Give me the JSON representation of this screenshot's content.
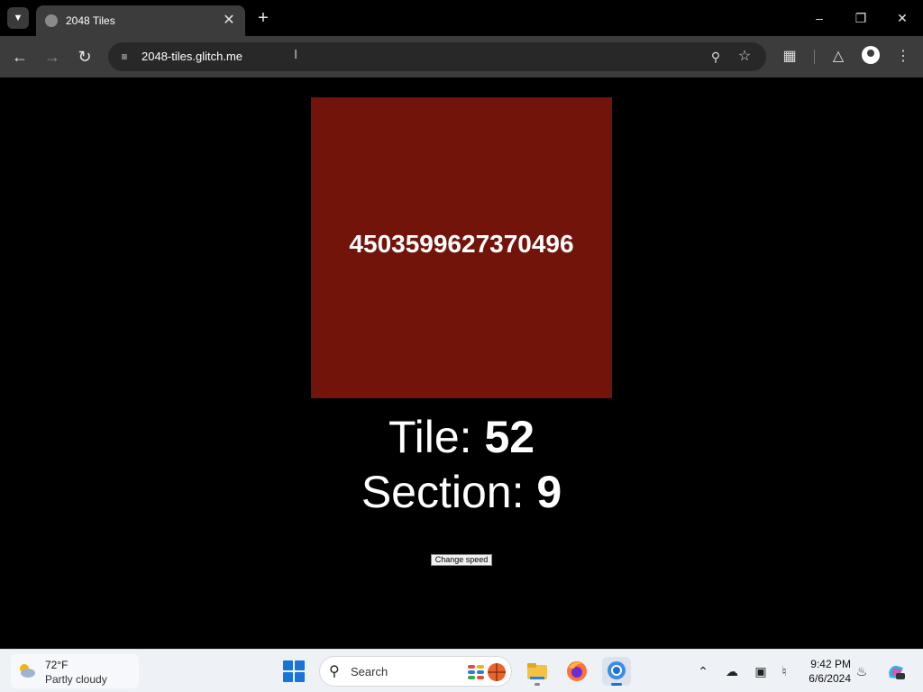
{
  "browser": {
    "tab_title": "2048 Tiles",
    "url": "2048-tiles.glitch.me"
  },
  "page": {
    "tile_value": "4503599627370496",
    "tile_color": "#72140a",
    "tile_label": "Tile: ",
    "tile_number": "52",
    "section_label": "Section: ",
    "section_number": "9",
    "change_speed_label": "Change speed"
  },
  "taskbar": {
    "weather_temp": "72°F",
    "weather_condition": "Partly cloudy",
    "search_placeholder": "Search",
    "time": "9:42 PM",
    "date": "6/6/2024"
  },
  "icons": {
    "tab_search": "chevron-down-icon",
    "favicon": "globe-icon",
    "back": "arrow-left-icon",
    "forward": "arrow-right-icon",
    "reload": "reload-icon",
    "site_info": "tune-icon",
    "zoom": "zoom-icon",
    "bookmark": "star-icon",
    "extensions": "puzzle-icon",
    "labs": "flask-icon",
    "profile": "profile-icon",
    "menu": "kebab-menu-icon"
  }
}
